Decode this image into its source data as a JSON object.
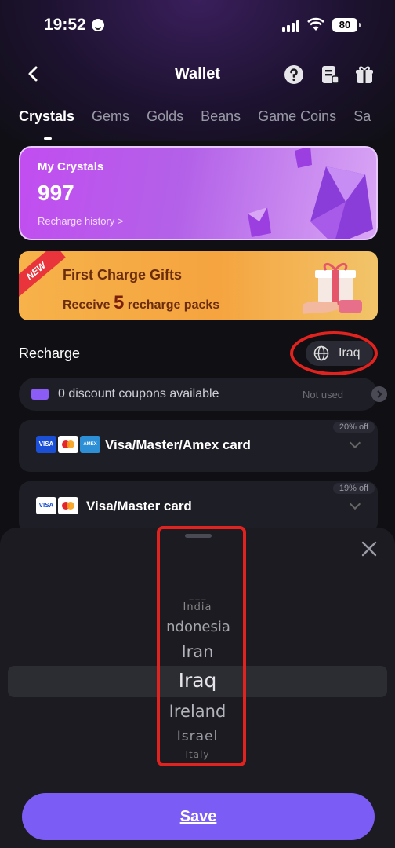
{
  "status_bar": {
    "time": "19:52",
    "battery": "80"
  },
  "header": {
    "title": "Wallet"
  },
  "tabs": [
    "Crystals",
    "Gems",
    "Golds",
    "Beans",
    "Game Coins",
    "Sa"
  ],
  "crystals_card": {
    "label": "My Crystals",
    "value": "997",
    "history_link": "Recharge history >"
  },
  "banner": {
    "badge": "NEW",
    "title": "First Charge Gifts",
    "subtitle_prefix": "Receive",
    "subtitle_number": "5",
    "subtitle_suffix": "recharge packs"
  },
  "recharge": {
    "title": "Recharge",
    "region": "Iraq"
  },
  "coupon": {
    "text": "0 discount coupons available",
    "status": "Not used"
  },
  "payment_methods": [
    {
      "label": "Visa/Master/Amex card",
      "discount": "20% off"
    },
    {
      "label": "Visa/Master card",
      "discount": "19% off"
    }
  ],
  "picker": {
    "items": [
      "India",
      "ndonesia",
      "Iran",
      "Iraq",
      "Ireland",
      "Israel",
      "Italy"
    ],
    "selected": "Iraq"
  },
  "save_button": {
    "label": "Save"
  },
  "colors": {
    "accent": "#7b5cf5",
    "annotation": "#e0231f",
    "card": "#c24df0",
    "banner": "#f5a43f"
  }
}
